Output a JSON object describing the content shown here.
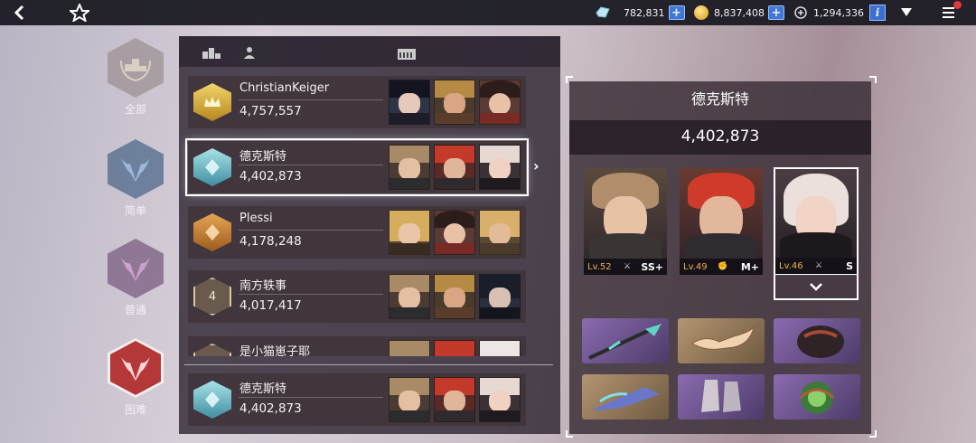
{
  "topbar": {
    "back_icon": "back-arrow-icon",
    "logo_icon": "star-logo-icon",
    "currency1": {
      "icon": "crystal-icon",
      "value": "782,831",
      "plus": "+"
    },
    "currency2": {
      "icon": "gold-coin-icon",
      "value": "8,837,408",
      "plus": "+"
    },
    "currency3": {
      "icon": "ticket-icon",
      "value": "1,294,336",
      "info": "i"
    },
    "dropdown_icon": "triangle-down-icon",
    "menu_icon": "hamburger-menu-icon",
    "colors": {
      "plus_bg": "#3f78d6",
      "notify": "#e23a3a"
    }
  },
  "difficulties": [
    {
      "label": "全部",
      "icon": "trophy-wreath-icon"
    },
    {
      "label": "简单",
      "icon": "bull-emblem-icon"
    },
    {
      "label": "普通",
      "icon": "bull-emblem-icon"
    },
    {
      "label": "困难",
      "icon": "bull-emblem-icon",
      "active": true
    }
  ],
  "ranking": {
    "header_icons": [
      "podium-icon",
      "person-icon",
      "team-icon"
    ],
    "rows": [
      {
        "rank_icon": "gold-crown-badge-icon",
        "rank_text": "",
        "name": "ChristianKeiger",
        "score": "4,757,557"
      },
      {
        "rank_icon": "teal-diamond-badge-icon",
        "rank_text": "",
        "name": "德克斯特",
        "score": "4,402,873",
        "selected": true
      },
      {
        "rank_icon": "bronze-diamond-badge-icon",
        "rank_text": "",
        "name": "Plessi",
        "score": "4,178,248"
      },
      {
        "rank_icon": "rank-hex-badge-icon",
        "rank_text": "4",
        "name": "南方轶事",
        "score": "4,017,417"
      },
      {
        "rank_icon": "rank-hex-badge-icon",
        "rank_text": "",
        "name": "是小猫崽子耶",
        "score": ""
      }
    ],
    "my_row": {
      "rank_icon": "teal-diamond-badge-icon",
      "name": "德克斯特",
      "score": "4,402,873"
    },
    "expand_arrow": "›"
  },
  "detail": {
    "title": "德克斯特",
    "score": "4,402,873",
    "characters": [
      {
        "level": "Lv.52",
        "grade": "SS+",
        "weapon_icon": "sword-icon"
      },
      {
        "level": "Lv.49",
        "grade": "M+",
        "weapon_icon": "fist-icon"
      },
      {
        "level": "Lv.46",
        "grade": "S",
        "weapon_icon": "sword-icon"
      }
    ],
    "expand_icon": "chevron-down-icon",
    "equipment": [
      {
        "icon": "spear-weapon-icon",
        "rarity_color": "#6a4f8d"
      },
      {
        "icon": "winged-crown-icon",
        "rarity_color": "#8e7454"
      },
      {
        "icon": "gauntlet-icon",
        "rarity_color": "#6a4f8d"
      },
      {
        "icon": "dragon-blade-icon",
        "rarity_color": "#8e7454"
      },
      {
        "icon": "boots-icon",
        "rarity_color": "#6a4f8d"
      },
      {
        "icon": "emerald-orb-icon",
        "rarity_color": "#6a4f8d"
      }
    ]
  }
}
